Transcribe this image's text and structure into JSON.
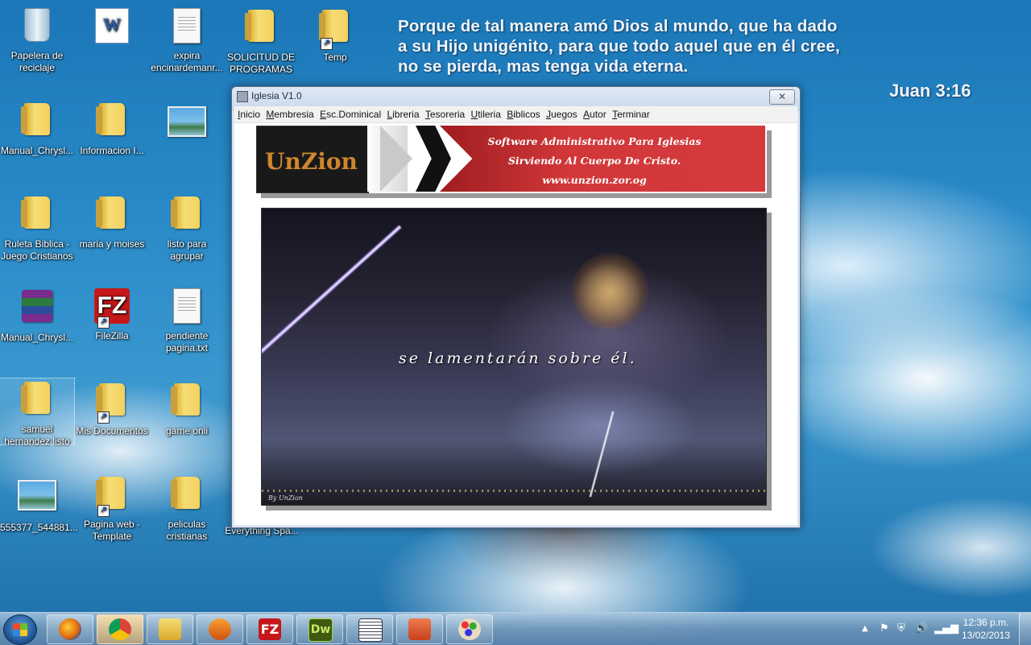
{
  "wallpaper": {
    "verse_lines": [
      "Porque de tal manera amó Dios al mundo,  que ha dado",
      "a su Hijo unigénito,  para que todo aquel que en él cree,",
      "no se pierda, mas tenga vida eterna."
    ],
    "verse_reference": "Juan 3:16"
  },
  "desktop_icons": [
    {
      "label": "Papelera de reciclaje",
      "type": "recycle-bin"
    },
    {
      "label": "Manual_Chrysl...",
      "type": "folder"
    },
    {
      "label": "Ruleta Biblica - Juego Cristianos",
      "type": "folder"
    },
    {
      "label": "Manual_Chrysl...",
      "type": "winrar"
    },
    {
      "label": "samuel hernandez listo",
      "type": "folder"
    },
    {
      "label": "555377_544881...",
      "type": "image"
    },
    {
      "label": "",
      "type": "word"
    },
    {
      "label": "Informacion I...",
      "type": "folder"
    },
    {
      "label": "maria y moises",
      "type": "folder"
    },
    {
      "label": "FileZilla",
      "type": "filezilla"
    },
    {
      "label": "Mis Documentos",
      "type": "folder"
    },
    {
      "label": "Pagina web - Template",
      "type": "folder"
    },
    {
      "label": "expira encinardemanr...",
      "type": "document"
    },
    {
      "label": "",
      "type": "image"
    },
    {
      "label": "listo para agrupar",
      "type": "folder"
    },
    {
      "label": "pendiente pagina.txt",
      "type": "document"
    },
    {
      "label": "game onli",
      "type": "folder"
    },
    {
      "label": "peliculas cristianas",
      "type": "folder"
    },
    {
      "label": "SOLICITUD DE PROGRAMAS",
      "type": "folder"
    },
    {
      "label": "Temp",
      "type": "folder"
    },
    {
      "label": "Everything Spa...",
      "type": "partial"
    }
  ],
  "window": {
    "title": "Iglesia V1.0",
    "close_symbol": "✕",
    "menu": [
      "Inicio",
      "Membresia",
      "Esc.Dominical",
      "Libreria",
      "Tesoreria",
      "Utileria",
      "Biblicos",
      "Juegos",
      "Autor",
      "Terminar"
    ],
    "banner": {
      "logo_text": "UnZion",
      "line1": "Software Administrativo Para Iglesias",
      "line2": "Sirviendo Al Cuerpo De Cristo.",
      "url": "www.unzion.zor.og"
    },
    "image": {
      "caption": "se lamentarán sobre él.",
      "signature": "By UnZion"
    }
  },
  "taskbar": {
    "apps": [
      "firefox",
      "chrome",
      "explorer",
      "media-player",
      "filezilla",
      "dreamweaver",
      "iglesia-app",
      "powerpoint",
      "paint"
    ],
    "app_labels": {
      "filezilla": "FZ",
      "dreamweaver": "Dw"
    },
    "clock_time": "12:36 p.m.",
    "clock_date": "13/02/2013"
  },
  "colors": {
    "banner_red": "#d23739",
    "logo_orange": "#d0862c",
    "window_frame": "#c9d9ec"
  }
}
